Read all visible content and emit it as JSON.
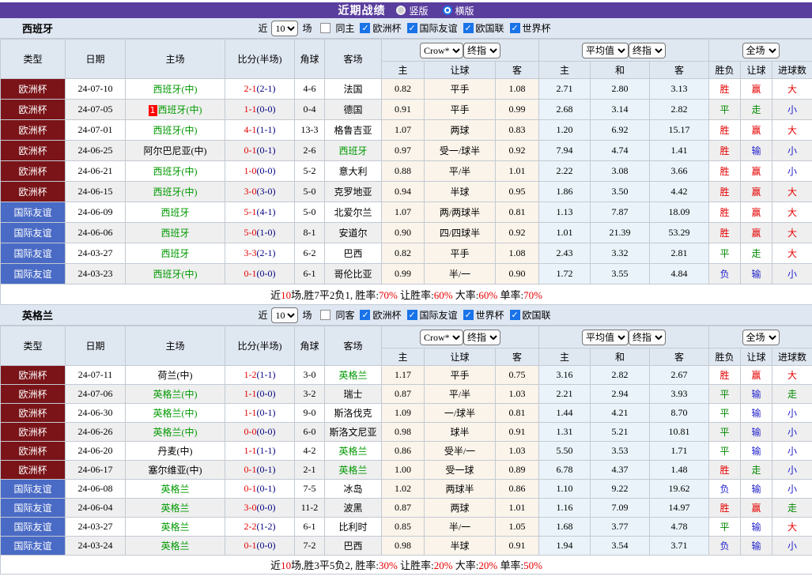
{
  "topbar": {
    "title": "近期战绩",
    "radios": [
      {
        "label": "竖版",
        "selected": false
      },
      {
        "label": "横版",
        "selected": true
      }
    ]
  },
  "table_header": {
    "main": [
      "类型",
      "日期",
      "主场",
      "比分(半场)",
      "角球",
      "客场"
    ],
    "sub": [
      "主",
      "让球",
      "客",
      "主",
      "和",
      "客",
      "胜负",
      "让球",
      "进球数"
    ],
    "selects": {
      "odds_source": "Crow*",
      "odds_time": "终指",
      "avg_source": "平均值",
      "avg_time": "终指",
      "scope": "全场"
    }
  },
  "colors": {
    "topbar_purple": "#5a3e9e",
    "accent_blue": "#1a73e8",
    "team_green": "#009900",
    "score_red": "#e60000",
    "half_navy": "#000080",
    "type_bg": {
      "欧洲杯": "#7a1418",
      "国际友谊": "#4a6bc5"
    },
    "result": {
      "胜": "#e60000",
      "赢": "#e60000",
      "大": "#e60000",
      "平": "#008800",
      "走": "#008800",
      "负": "#2222cc",
      "输": "#2222cc",
      "小": "#2222cc"
    }
  },
  "sections": [
    {
      "team": "西班牙",
      "filter": {
        "near": "近",
        "count": "10",
        "games": "场",
        "same": {
          "label": "同主",
          "checked": false
        },
        "comps": [
          {
            "label": "欧洲杯",
            "checked": true
          },
          {
            "label": "国际友谊",
            "checked": true
          },
          {
            "label": "欧国联",
            "checked": true
          },
          {
            "label": "世界杯",
            "checked": true
          }
        ]
      },
      "rows": [
        {
          "type": "欧洲杯",
          "date": "24-07-10",
          "home": "西班牙(中)",
          "home_green": true,
          "home_card": "",
          "score": "2-1",
          "half": "(2-1)",
          "corner": "4-6",
          "away": "法国",
          "away_green": false,
          "h_home": "0.82",
          "handicap": "平手",
          "h_away": "1.08",
          "avg_h": "2.71",
          "avg_d": "2.80",
          "avg_a": "3.13",
          "r_wdl": "胜",
          "r_hcp": "赢",
          "r_goal": "大"
        },
        {
          "type": "欧洲杯",
          "date": "24-07-05",
          "home": "西班牙(中)",
          "home_green": true,
          "home_card": "1",
          "score": "1-1",
          "half": "(0-0)",
          "corner": "0-4",
          "away": "德国",
          "away_green": false,
          "h_home": "0.91",
          "handicap": "平手",
          "h_away": "0.99",
          "avg_h": "2.68",
          "avg_d": "3.14",
          "avg_a": "2.82",
          "r_wdl": "平",
          "r_hcp": "走",
          "r_goal": "小"
        },
        {
          "type": "欧洲杯",
          "date": "24-07-01",
          "home": "西班牙(中)",
          "home_green": true,
          "home_card": "",
          "score": "4-1",
          "half": "(1-1)",
          "corner": "13-3",
          "away": "格鲁吉亚",
          "away_green": false,
          "h_home": "1.07",
          "handicap": "两球",
          "h_away": "0.83",
          "avg_h": "1.20",
          "avg_d": "6.92",
          "avg_a": "15.17",
          "r_wdl": "胜",
          "r_hcp": "赢",
          "r_goal": "大"
        },
        {
          "type": "欧洲杯",
          "date": "24-06-25",
          "home": "阿尔巴尼亚(中)",
          "home_green": false,
          "home_card": "",
          "score": "0-1",
          "half": "(0-1)",
          "corner": "2-6",
          "away": "西班牙",
          "away_green": true,
          "h_home": "0.97",
          "handicap": "受一/球半",
          "h_away": "0.92",
          "avg_h": "7.94",
          "avg_d": "4.74",
          "avg_a": "1.41",
          "r_wdl": "胜",
          "r_hcp": "输",
          "r_goal": "小"
        },
        {
          "type": "欧洲杯",
          "date": "24-06-21",
          "home": "西班牙(中)",
          "home_green": true,
          "home_card": "",
          "score": "1-0",
          "half": "(0-0)",
          "corner": "5-2",
          "away": "意大利",
          "away_green": false,
          "h_home": "0.88",
          "handicap": "平/半",
          "h_away": "1.01",
          "avg_h": "2.22",
          "avg_d": "3.08",
          "avg_a": "3.66",
          "r_wdl": "胜",
          "r_hcp": "赢",
          "r_goal": "小"
        },
        {
          "type": "欧洲杯",
          "date": "24-06-15",
          "home": "西班牙(中)",
          "home_green": true,
          "home_card": "",
          "score": "3-0",
          "half": "(3-0)",
          "corner": "5-0",
          "away": "克罗地亚",
          "away_green": false,
          "h_home": "0.94",
          "handicap": "半球",
          "h_away": "0.95",
          "avg_h": "1.86",
          "avg_d": "3.50",
          "avg_a": "4.42",
          "r_wdl": "胜",
          "r_hcp": "赢",
          "r_goal": "大"
        },
        {
          "type": "国际友谊",
          "date": "24-06-09",
          "home": "西班牙",
          "home_green": true,
          "home_card": "",
          "score": "5-1",
          "half": "(4-1)",
          "corner": "5-0",
          "away": "北爱尔兰",
          "away_green": false,
          "h_home": "1.07",
          "handicap": "两/两球半",
          "h_away": "0.81",
          "avg_h": "1.13",
          "avg_d": "7.87",
          "avg_a": "18.09",
          "r_wdl": "胜",
          "r_hcp": "赢",
          "r_goal": "大"
        },
        {
          "type": "国际友谊",
          "date": "24-06-06",
          "home": "西班牙",
          "home_green": true,
          "home_card": "",
          "score": "5-0",
          "half": "(1-0)",
          "corner": "8-1",
          "away": "安道尔",
          "away_green": false,
          "h_home": "0.90",
          "handicap": "四/四球半",
          "h_away": "0.92",
          "avg_h": "1.01",
          "avg_d": "21.39",
          "avg_a": "53.29",
          "r_wdl": "胜",
          "r_hcp": "赢",
          "r_goal": "大"
        },
        {
          "type": "国际友谊",
          "date": "24-03-27",
          "home": "西班牙",
          "home_green": true,
          "home_card": "",
          "score": "3-3",
          "half": "(2-1)",
          "corner": "6-2",
          "away": "巴西",
          "away_green": false,
          "h_home": "0.82",
          "handicap": "平手",
          "h_away": "1.08",
          "avg_h": "2.43",
          "avg_d": "3.32",
          "avg_a": "2.81",
          "r_wdl": "平",
          "r_hcp": "走",
          "r_goal": "大"
        },
        {
          "type": "国际友谊",
          "date": "24-03-23",
          "home": "西班牙(中)",
          "home_green": true,
          "home_card": "",
          "score": "0-1",
          "half": "(0-0)",
          "corner": "6-1",
          "away": "哥伦比亚",
          "away_green": false,
          "h_home": "0.99",
          "handicap": "半/一",
          "h_away": "0.90",
          "avg_h": "1.72",
          "avg_d": "3.55",
          "avg_a": "4.84",
          "r_wdl": "负",
          "r_hcp": "输",
          "r_goal": "小"
        }
      ],
      "summary": [
        {
          "text": "近"
        },
        {
          "text": "10",
          "red": true
        },
        {
          "text": "场,胜7平2负1, 胜率:"
        },
        {
          "text": "70%",
          "red": true
        },
        {
          "text": " 让胜率:"
        },
        {
          "text": "60%",
          "red": true
        },
        {
          "text": " 大率:"
        },
        {
          "text": "60%",
          "red": true
        },
        {
          "text": " 单率:"
        },
        {
          "text": "70%",
          "red": true
        }
      ]
    },
    {
      "team": "英格兰",
      "filter": {
        "near": "近",
        "count": "10",
        "games": "场",
        "same": {
          "label": "同客",
          "checked": false
        },
        "comps": [
          {
            "label": "欧洲杯",
            "checked": true
          },
          {
            "label": "国际友谊",
            "checked": true
          },
          {
            "label": "世界杯",
            "checked": true
          },
          {
            "label": "欧国联",
            "checked": true
          }
        ]
      },
      "rows": [
        {
          "type": "欧洲杯",
          "date": "24-07-11",
          "home": "荷兰(中)",
          "home_green": false,
          "home_card": "",
          "score": "1-2",
          "half": "(1-1)",
          "corner": "3-0",
          "away": "英格兰",
          "away_green": true,
          "h_home": "1.17",
          "handicap": "平手",
          "h_away": "0.75",
          "avg_h": "3.16",
          "avg_d": "2.82",
          "avg_a": "2.67",
          "r_wdl": "胜",
          "r_hcp": "赢",
          "r_goal": "大"
        },
        {
          "type": "欧洲杯",
          "date": "24-07-06",
          "home": "英格兰(中)",
          "home_green": true,
          "home_card": "",
          "score": "1-1",
          "half": "(0-0)",
          "corner": "3-2",
          "away": "瑞士",
          "away_green": false,
          "h_home": "0.87",
          "handicap": "平/半",
          "h_away": "1.03",
          "avg_h": "2.21",
          "avg_d": "2.94",
          "avg_a": "3.93",
          "r_wdl": "平",
          "r_hcp": "输",
          "r_goal": "走"
        },
        {
          "type": "欧洲杯",
          "date": "24-06-30",
          "home": "英格兰(中)",
          "home_green": true,
          "home_card": "",
          "score": "1-1",
          "half": "(0-1)",
          "corner": "9-0",
          "away": "斯洛伐克",
          "away_green": false,
          "h_home": "1.09",
          "handicap": "一/球半",
          "h_away": "0.81",
          "avg_h": "1.44",
          "avg_d": "4.21",
          "avg_a": "8.70",
          "r_wdl": "平",
          "r_hcp": "输",
          "r_goal": "小"
        },
        {
          "type": "欧洲杯",
          "date": "24-06-26",
          "home": "英格兰(中)",
          "home_green": true,
          "home_card": "",
          "score": "0-0",
          "half": "(0-0)",
          "corner": "6-0",
          "away": "斯洛文尼亚",
          "away_green": false,
          "h_home": "0.98",
          "handicap": "球半",
          "h_away": "0.91",
          "avg_h": "1.31",
          "avg_d": "5.21",
          "avg_a": "10.81",
          "r_wdl": "平",
          "r_hcp": "输",
          "r_goal": "小"
        },
        {
          "type": "欧洲杯",
          "date": "24-06-20",
          "home": "丹麦(中)",
          "home_green": false,
          "home_card": "",
          "score": "1-1",
          "half": "(1-1)",
          "corner": "4-2",
          "away": "英格兰",
          "away_green": true,
          "h_home": "0.86",
          "handicap": "受半/一",
          "h_away": "1.03",
          "avg_h": "5.50",
          "avg_d": "3.53",
          "avg_a": "1.71",
          "r_wdl": "平",
          "r_hcp": "输",
          "r_goal": "小"
        },
        {
          "type": "欧洲杯",
          "date": "24-06-17",
          "home": "塞尔维亚(中)",
          "home_green": false,
          "home_card": "",
          "score": "0-1",
          "half": "(0-1)",
          "corner": "2-1",
          "away": "英格兰",
          "away_green": true,
          "h_home": "1.00",
          "handicap": "受一球",
          "h_away": "0.89",
          "avg_h": "6.78",
          "avg_d": "4.37",
          "avg_a": "1.48",
          "r_wdl": "胜",
          "r_hcp": "走",
          "r_goal": "小"
        },
        {
          "type": "国际友谊",
          "date": "24-06-08",
          "home": "英格兰",
          "home_green": true,
          "home_card": "",
          "score": "0-1",
          "half": "(0-1)",
          "corner": "7-5",
          "away": "冰岛",
          "away_green": false,
          "h_home": "1.02",
          "handicap": "两球半",
          "h_away": "0.86",
          "avg_h": "1.10",
          "avg_d": "9.22",
          "avg_a": "19.62",
          "r_wdl": "负",
          "r_hcp": "输",
          "r_goal": "小"
        },
        {
          "type": "国际友谊",
          "date": "24-06-04",
          "home": "英格兰",
          "home_green": true,
          "home_card": "",
          "score": "3-0",
          "half": "(0-0)",
          "corner": "11-2",
          "away": "波黑",
          "away_green": false,
          "h_home": "0.87",
          "handicap": "两球",
          "h_away": "1.01",
          "avg_h": "1.16",
          "avg_d": "7.09",
          "avg_a": "14.97",
          "r_wdl": "胜",
          "r_hcp": "赢",
          "r_goal": "走"
        },
        {
          "type": "国际友谊",
          "date": "24-03-27",
          "home": "英格兰",
          "home_green": true,
          "home_card": "",
          "score": "2-2",
          "half": "(1-2)",
          "corner": "6-1",
          "away": "比利时",
          "away_green": false,
          "h_home": "0.85",
          "handicap": "半/一",
          "h_away": "1.05",
          "avg_h": "1.68",
          "avg_d": "3.77",
          "avg_a": "4.78",
          "r_wdl": "平",
          "r_hcp": "输",
          "r_goal": "大"
        },
        {
          "type": "国际友谊",
          "date": "24-03-24",
          "home": "英格兰",
          "home_green": true,
          "home_card": "",
          "score": "0-1",
          "half": "(0-0)",
          "corner": "7-2",
          "away": "巴西",
          "away_green": false,
          "h_home": "0.98",
          "handicap": "半球",
          "h_away": "0.91",
          "avg_h": "1.94",
          "avg_d": "3.54",
          "avg_a": "3.71",
          "r_wdl": "负",
          "r_hcp": "输",
          "r_goal": "小"
        }
      ],
      "summary": [
        {
          "text": "近"
        },
        {
          "text": "10",
          "red": true
        },
        {
          "text": "场,胜3平5负2, 胜率:"
        },
        {
          "text": "30%",
          "red": true
        },
        {
          "text": " 让胜率:"
        },
        {
          "text": "20%",
          "red": true
        },
        {
          "text": " 大率:"
        },
        {
          "text": "20%",
          "red": true
        },
        {
          "text": " 单率:"
        },
        {
          "text": "50%",
          "red": true
        }
      ]
    }
  ]
}
